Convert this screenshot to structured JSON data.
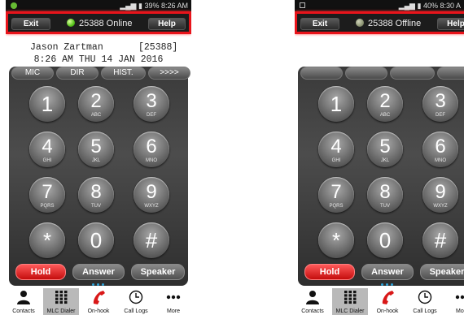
{
  "left": {
    "status_time": "8:26 AM",
    "status_battery": "39%",
    "exit_label": "Exit",
    "help_label": "Help",
    "connection_text": "25388 Online",
    "caller_name": "Jason Zartman",
    "caller_ext": "[25388]",
    "datetime": "8:26 AM THU 14 JAN 2016",
    "tabs": [
      "MIC",
      "DIR",
      "HIST.",
      ">>>>"
    ],
    "hold_label": "Hold",
    "answer_label": "Answer",
    "speaker_label": "Speaker"
  },
  "right": {
    "status_time": "8:30 A",
    "status_battery": "40%",
    "exit_label": "Exit",
    "help_label": "Help",
    "connection_text": "25388 Offline",
    "hold_label": "Hold",
    "answer_label": "Answer",
    "speaker_label": "Speaker"
  },
  "keypad": [
    {
      "digit": "1",
      "letters": ""
    },
    {
      "digit": "2",
      "letters": "ABC"
    },
    {
      "digit": "3",
      "letters": "DEF"
    },
    {
      "digit": "4",
      "letters": "GHI"
    },
    {
      "digit": "5",
      "letters": "JKL"
    },
    {
      "digit": "6",
      "letters": "MNO"
    },
    {
      "digit": "7",
      "letters": "PQRS"
    },
    {
      "digit": "8",
      "letters": "TUV"
    },
    {
      "digit": "9",
      "letters": "WXYZ"
    },
    {
      "digit": "*",
      "letters": ""
    },
    {
      "digit": "0",
      "letters": ""
    },
    {
      "digit": "#",
      "letters": ""
    }
  ],
  "nav_items": [
    {
      "label": "Contacts",
      "icon": "contacts-icon"
    },
    {
      "label": "MLC Dialer",
      "icon": "dialpad-icon",
      "active": true
    },
    {
      "label": "On-hook",
      "icon": "handset-icon"
    },
    {
      "label": "Call Logs",
      "icon": "clock-icon"
    },
    {
      "label": "More",
      "icon": "more-icon"
    }
  ],
  "colors": {
    "highlight": "#e8141b",
    "hold": "#d91818",
    "online_led": "#56c21b",
    "offline_led": "#8d9574",
    "active_nav": "#b9b9b9"
  }
}
